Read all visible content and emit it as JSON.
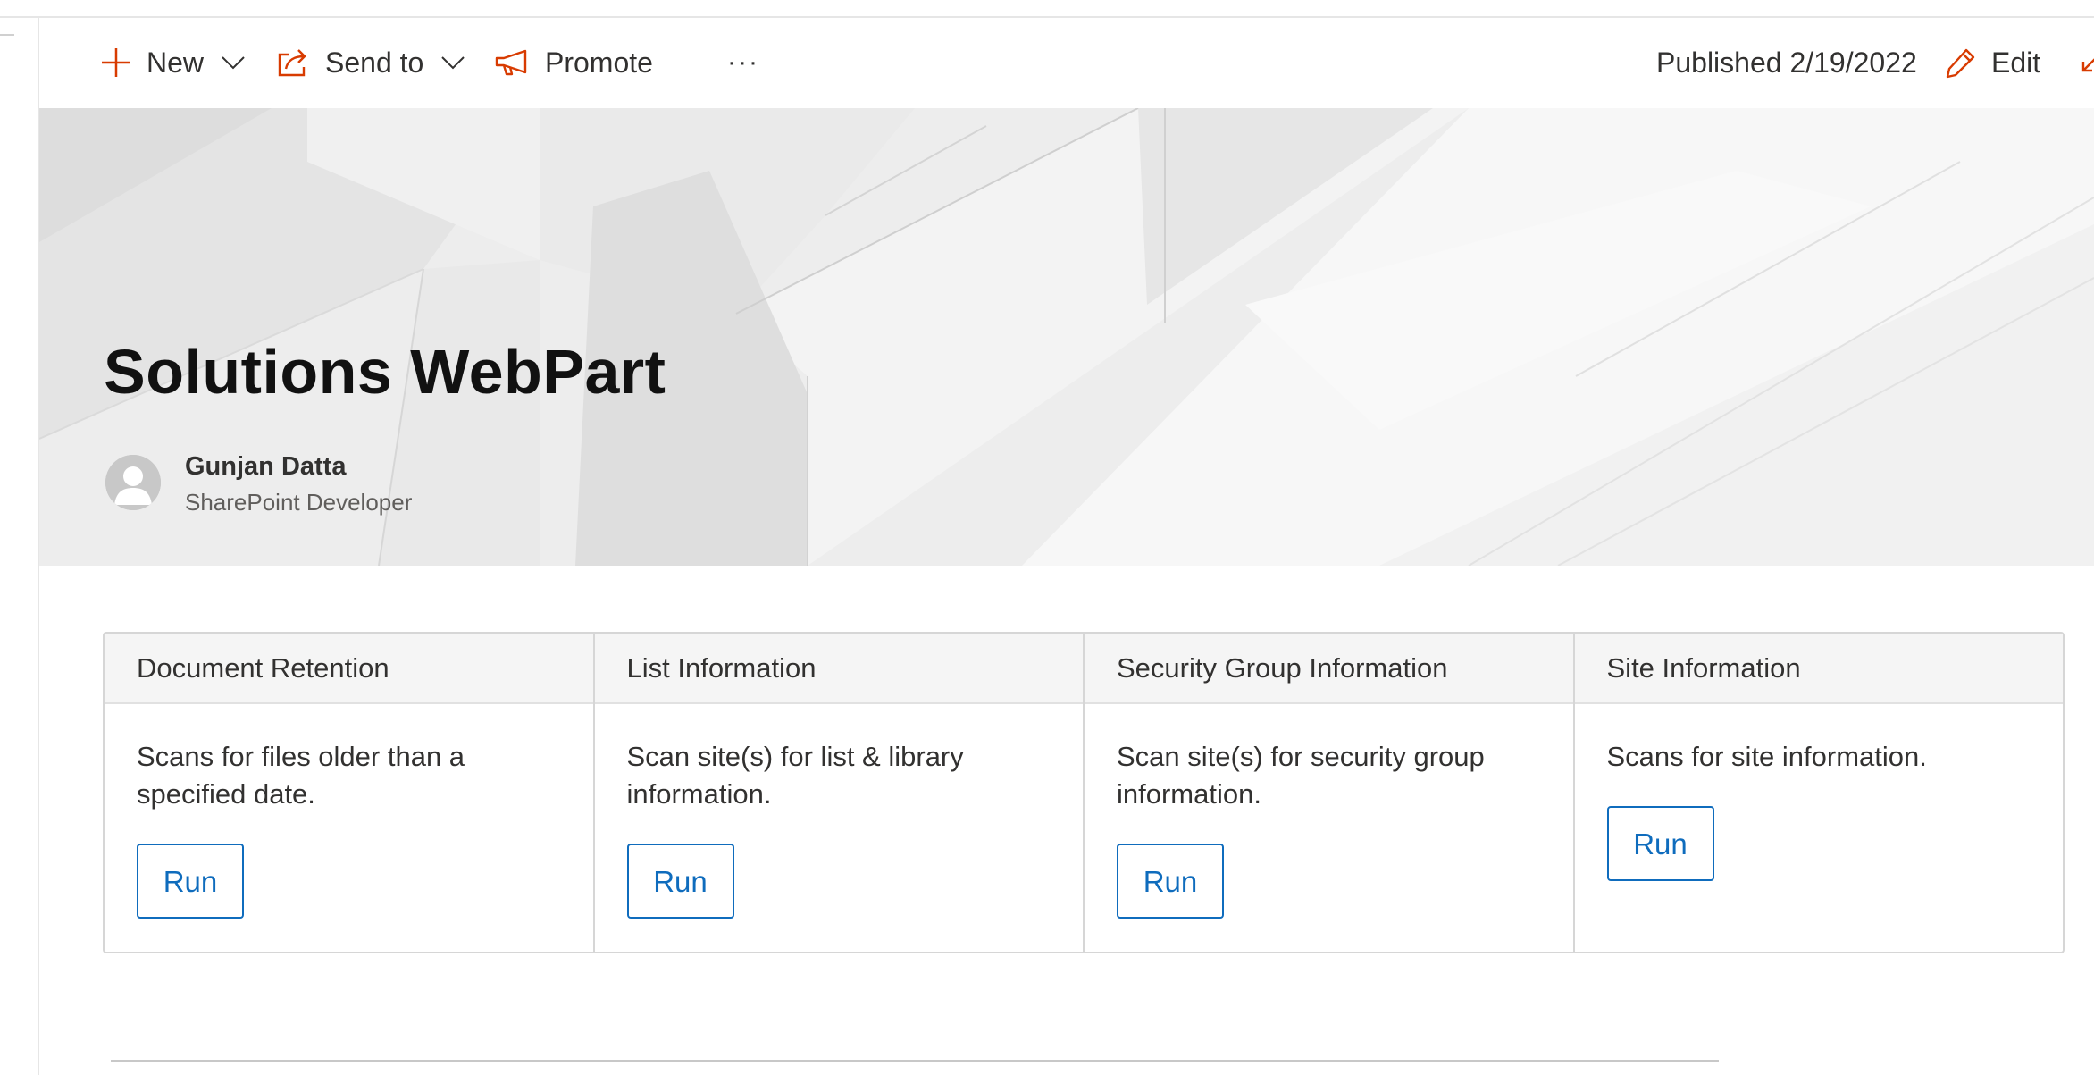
{
  "command_bar": {
    "new_label": "New",
    "send_to_label": "Send to",
    "promote_label": "Promote",
    "more_label": "···",
    "published_label": "Published 2/19/2022",
    "edit_label": "Edit",
    "accent_color": "#d83b01"
  },
  "hero": {
    "title": "Solutions WebPart",
    "author_name": "Gunjan Datta",
    "author_role": "SharePoint Developer"
  },
  "cards": [
    {
      "title": "Document Retention",
      "description": "Scans for files older than a specified date.",
      "button": "Run"
    },
    {
      "title": "List Information",
      "description": "Scan site(s) for list & library information.",
      "button": "Run"
    },
    {
      "title": "Security Group Information",
      "description": "Scan site(s) for security group information.",
      "button": "Run"
    },
    {
      "title": "Site Information",
      "description": "Scans for site information.",
      "button": "Run"
    }
  ],
  "button_color": "#0f6cbd"
}
